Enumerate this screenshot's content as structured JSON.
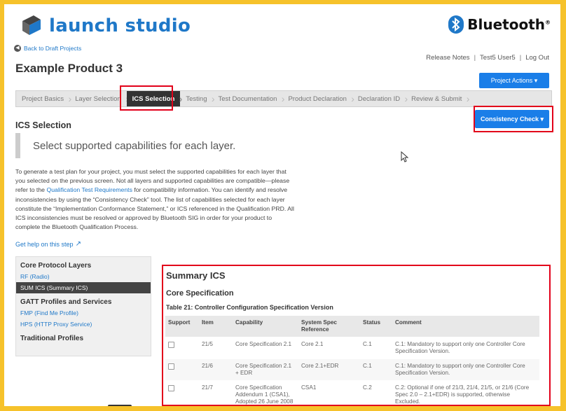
{
  "header": {
    "logo_text": "launch studio",
    "bluetooth_text": "Bluetooth",
    "bluetooth_reg": "®",
    "back_link": "Back to Draft Projects",
    "product_title": "Example Product 3",
    "top_links": [
      "Release Notes",
      "Test5 User5",
      "Log Out"
    ],
    "project_actions_label": "Project Actions ▾"
  },
  "tabs": [
    {
      "label": "Project Basics",
      "active": false
    },
    {
      "label": "Layer Selection",
      "active": false
    },
    {
      "label": "ICS Selection",
      "active": true
    },
    {
      "label": "Testing",
      "active": false
    },
    {
      "label": "Test Documentation",
      "active": false
    },
    {
      "label": "Product Declaration",
      "active": false
    },
    {
      "label": "Declaration ID",
      "active": false
    },
    {
      "label": "Review & Submit",
      "active": false
    }
  ],
  "page": {
    "heading": "ICS Selection",
    "consistency_label": "Consistency Check ▾",
    "callout": "Select supported capabilities for each layer.",
    "intro_before_link": "To generate a test plan for your project, you must select the supported capabilities for each layer that you selected on the previous screen. Not all layers and supported capabilities are compatible—please refer to the ",
    "intro_link": "Qualification Test Requirements",
    "intro_after_link": " for compatibility information. You can identify and resolve inconsistencies by using the “Consistency Check” tool. The list of capabilities selected for each layer constitute the “Implementation Conformance Statement,” or ICS referenced in the Qualification PRD. All ICS inconsistencies must be resolved or approved by Bluetooth SIG in order for your product to complete the Bluetooth Qualification Process.",
    "help_link": "Get help on this step"
  },
  "sidebar": {
    "core_heading": "Core Protocol Layers",
    "core_items": [
      {
        "label": "RF (Radio)",
        "active": false
      },
      {
        "label": "SUM ICS (Summary ICS)",
        "active": true
      }
    ],
    "gatt_heading": "GATT Profiles and Services",
    "gatt_items": [
      {
        "label": "FMP (Find Me Profile)",
        "active": false
      },
      {
        "label": "HPS (HTTP Proxy Service)",
        "active": false
      }
    ],
    "traditional_heading": "Traditional Profiles"
  },
  "summary": {
    "title": "Summary ICS",
    "section": "Core Specification",
    "table_caption": "Table 21: Controller Configuration Specification Version",
    "columns": [
      "Support",
      "Item",
      "Capability",
      "System Spec Reference",
      "Status",
      "Comment"
    ],
    "rows": [
      {
        "item": "21/5",
        "capability": "Core Specification 2.1",
        "reference": "Core 2.1",
        "status": "C.1",
        "comment": "C.1: Mandatory to support only one Controller Core Specification Version."
      },
      {
        "item": "21/6",
        "capability": "Core Specification 2.1 + EDR",
        "reference": "Core 2.1+EDR",
        "status": "C.1",
        "comment": "C.1: Mandatory to support only one Controller Core Specification Version."
      },
      {
        "item": "21/7",
        "capability": "Core Specification Addendum 1 (CSA1), Adopted 26 June 2008",
        "reference": "CSA1",
        "status": "C.2",
        "comment": "C.2: Optional if one of 21/3, 21/4, 21/5, or 21/6 (Core Spec 2.0 – 2.1+EDR) is supported, otherwise Excluded."
      }
    ]
  },
  "colors": {
    "accent": "#1a7ee8",
    "brand": "#1f78c8",
    "highlight": "#e2001a",
    "outer_frame": "#f6c22b"
  }
}
